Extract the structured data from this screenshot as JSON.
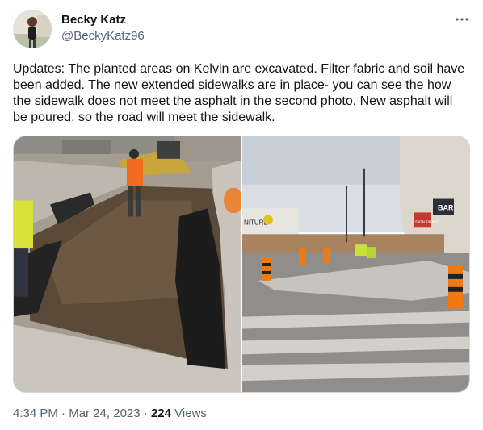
{
  "author": {
    "display_name": "Becky Katz",
    "handle": "@BeckyKatz96"
  },
  "tweet": {
    "text": "Updates: The planted areas on Kelvin are excavated. Filter fabric and soil have been added. The new extended sidewalks are in place- you can see the how the sidewalk does not meet the asphalt in the second photo. New asphalt will be poured, so the road will meet the sidewalk.",
    "time": "4:34 PM",
    "date": "Mar 24, 2023",
    "separator": "·",
    "views_count": "224",
    "views_label": "Views"
  },
  "photos": {
    "photo_1_signs": [],
    "photo_2_signs": [
      "BAR",
      "NITURE",
      "SIGN PRINT"
    ]
  },
  "icons": {
    "more": "more-horizontal-icon"
  }
}
